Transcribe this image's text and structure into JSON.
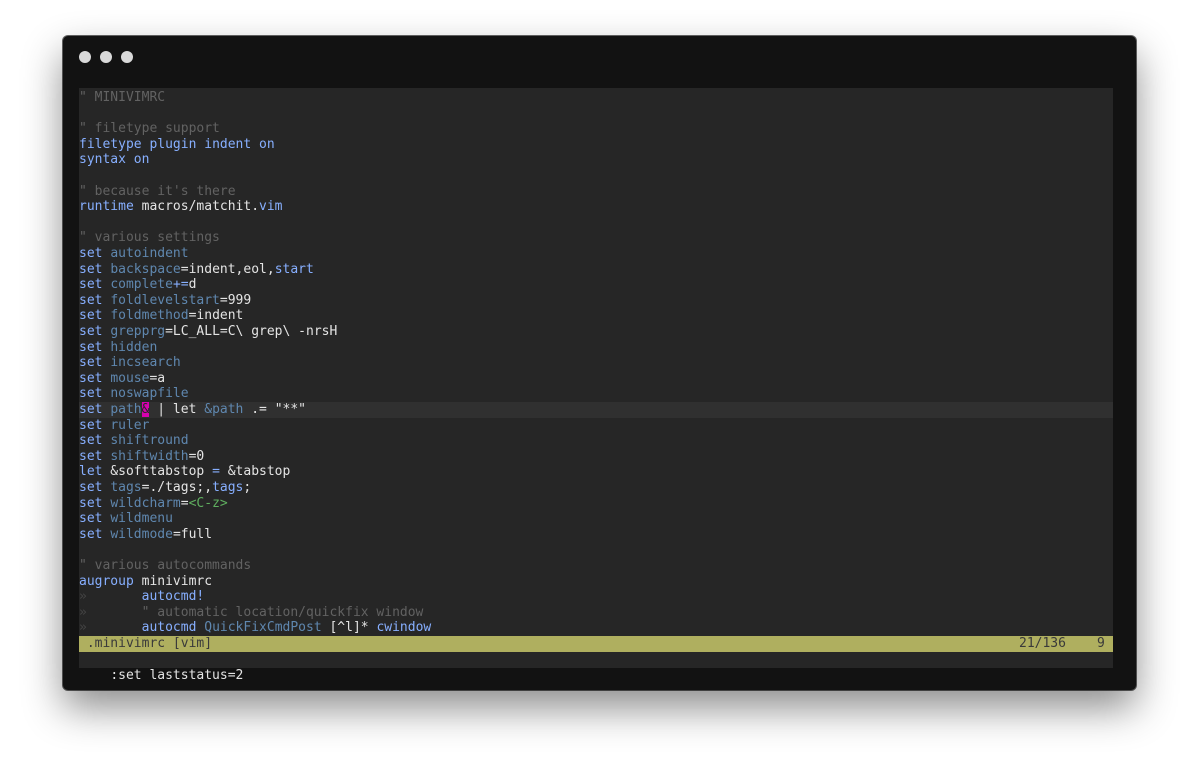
{
  "window": {
    "controls": [
      "close-dot",
      "minimize-dot",
      "zoom-dot"
    ]
  },
  "buffer": {
    "lines": [
      "\" MINIVIMRC",
      "",
      "\" filetype support",
      "filetype plugin indent on",
      "syntax on",
      "",
      "\" because it's there",
      "runtime macros/matchit.vim",
      "",
      "\" various settings",
      "set autoindent",
      "set backspace=indent,eol,start",
      "set complete+=d",
      "set foldlevelstart=999",
      "set foldmethod=indent",
      "set grepprg=LC_ALL=C\\ grep\\ -nrsH",
      "set hidden",
      "set incsearch",
      "set mouse=a",
      "set noswapfile",
      "set path& | let &path .= \"**\"",
      "set ruler",
      "set shiftround",
      "set shiftwidth=0",
      "let &softtabstop = &tabstop",
      "set tags=./tags;,tags;",
      "set wildcharm=<C-z>",
      "set wildmenu",
      "set wildmode=full",
      "",
      "\" various autocommands",
      "augroup minivimrc",
      "»       autocmd!",
      "»       \" automatic location/quickfix window",
      "»       autocmd QuickFixCmdPost [^l]* cwindow"
    ],
    "cursor_line": 21,
    "cursor_char": "&"
  },
  "statusline": {
    "file": " .minivimrc [vim]",
    "position": "21/136",
    "column": "9"
  },
  "cmdline": {
    "text": ":set laststatus=2"
  },
  "colors": {
    "window_bg": "#121212",
    "editor_bg": "#262626",
    "cursorline_bg": "#303030",
    "comment": "#626262",
    "keyword": "#87afff",
    "option": "#5f87af",
    "special": "#5faf5f",
    "cursor": "#d700af",
    "statusline_bg": "#afaf5f"
  }
}
